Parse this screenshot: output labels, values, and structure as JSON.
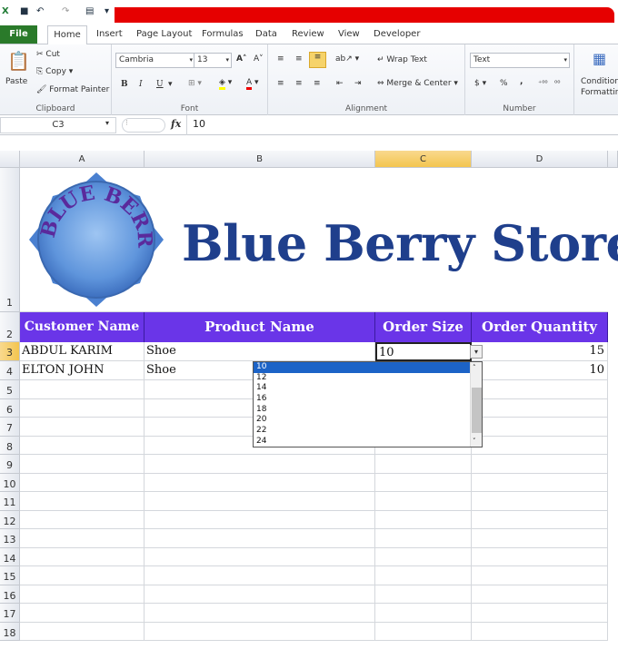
{
  "ribbon_tabs": [
    "File",
    "Home",
    "Insert",
    "Page Layout",
    "Formulas",
    "Data",
    "Review",
    "View",
    "Developer"
  ],
  "clipboard": {
    "paste": "Paste",
    "cut": "Cut",
    "copy": "Copy",
    "format_painter": "Format Painter",
    "label": "Clipboard"
  },
  "font": {
    "name": "Cambria",
    "size": "13",
    "label": "Font",
    "bold": "B",
    "italic": "I",
    "underline": "U"
  },
  "alignment": {
    "wrap": "Wrap Text",
    "merge": "Merge & Center",
    "label": "Alignment"
  },
  "number": {
    "format": "Text",
    "currency": "$",
    "percent": "%",
    "comma": ",",
    "label": "Number"
  },
  "styles": {
    "conditional": "Conditional Formatting"
  },
  "formula_bar": {
    "name_box": "C3",
    "fx": "fx",
    "value": "10"
  },
  "columns": [
    "A",
    "B",
    "C",
    "D"
  ],
  "rows": [
    "1",
    "2",
    "3",
    "4",
    "5",
    "6",
    "7",
    "8",
    "9",
    "10",
    "11",
    "12",
    "13",
    "14",
    "15",
    "16",
    "17",
    "18"
  ],
  "banner": {
    "logo_text": "BLUE BERRY",
    "title": "Blue Berry Store"
  },
  "headers": [
    "Customer Name",
    "Product Name",
    "Order Size",
    "Order Quantity"
  ],
  "data_rows": [
    {
      "customer": "ABDUL KARIM",
      "product": "Shoe",
      "size": "10",
      "qty": "15"
    },
    {
      "customer": "ELTON JOHN",
      "product": "Shoe",
      "size": "",
      "qty": "10"
    }
  ],
  "dropdown_options": [
    "10",
    "12",
    "14",
    "16",
    "18",
    "20",
    "22",
    "24"
  ],
  "colors": {
    "header_bg": "#6a35e8",
    "title": "#1f3f8c",
    "file_tab": "#2a7a2a",
    "selected": "#1c63c7"
  }
}
